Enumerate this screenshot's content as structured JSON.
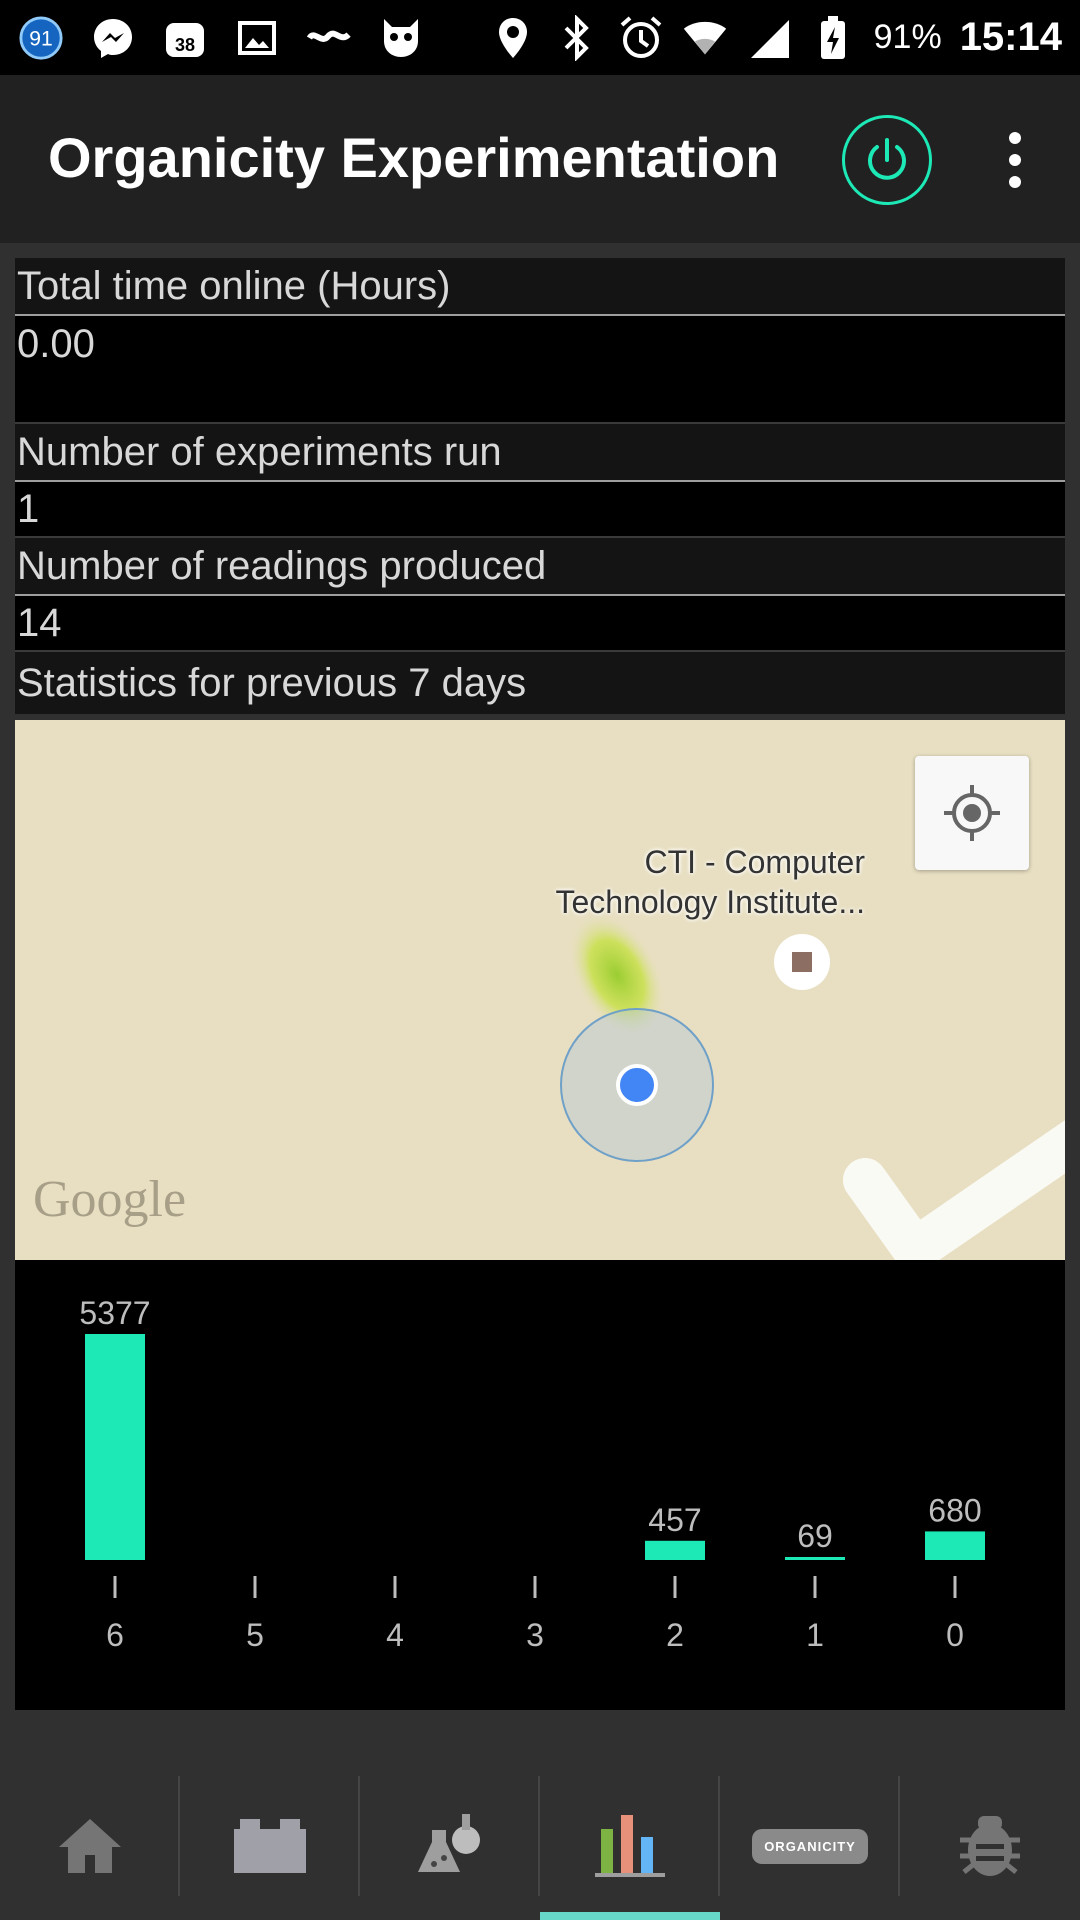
{
  "statusbar": {
    "notification_count": "91",
    "calendar_day": "38",
    "battery": "91%",
    "time": "15:14"
  },
  "appbar": {
    "title": "Organicity Experimentation"
  },
  "stats": {
    "total_time_label": "Total time online (Hours)",
    "total_time_value": "0.00",
    "experiments_label": "Number of experiments run",
    "experiments_value": "1",
    "readings_label": "Number of readings produced",
    "readings_value": "14",
    "weekly_label": "Statistics for previous 7 days"
  },
  "map": {
    "poi_line1": "CTI - Computer",
    "poi_line2": "Technology Institute...",
    "attribution": "Google"
  },
  "chart_data": {
    "type": "bar",
    "categories": [
      "6",
      "5",
      "4",
      "3",
      "2",
      "1",
      "0"
    ],
    "values": [
      5377,
      0,
      0,
      0,
      457,
      69,
      680
    ],
    "labels": [
      "5377",
      "",
      "",
      "",
      "457",
      "69",
      "680"
    ],
    "title": "",
    "xlabel": "",
    "ylabel": "",
    "ylim": [
      0,
      5377
    ],
    "bar_color": "#1de9b6"
  },
  "nav": {
    "logo_text": "ORGANICITY",
    "active_index": 3
  }
}
